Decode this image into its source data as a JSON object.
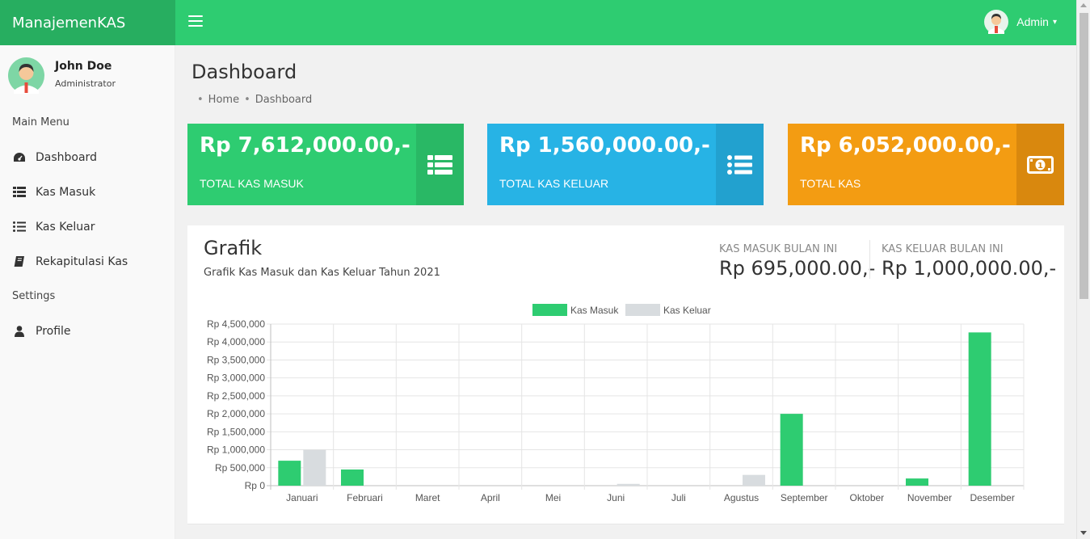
{
  "app": {
    "brand": "ManajemenKAS"
  },
  "topbar": {
    "user_label": "Admin"
  },
  "sidebar": {
    "user": {
      "name": "John Doe",
      "role": "Administrator"
    },
    "main_header": "Main Menu",
    "main_items": [
      {
        "label": "Dashboard",
        "icon": "dashboard-icon"
      },
      {
        "label": "Kas Masuk",
        "icon": "list-icon"
      },
      {
        "label": "Kas Keluar",
        "icon": "list-bullet-icon"
      },
      {
        "label": "Rekapitulasi Kas",
        "icon": "book-icon"
      }
    ],
    "settings_header": "Settings",
    "settings_items": [
      {
        "label": "Profile",
        "icon": "user-icon"
      }
    ]
  },
  "page": {
    "title": "Dashboard",
    "breadcrumb": [
      "Home",
      "Dashboard"
    ]
  },
  "boxes": [
    {
      "amount": "Rp 7,612,000.00,-",
      "label": "TOTAL KAS MASUK",
      "color": "#2ecc71",
      "icon": "table-list-icon"
    },
    {
      "amount": "Rp 1,560,000.00,-",
      "label": "TOTAL KAS KELUAR",
      "color": "#27b3e5",
      "icon": "list-bullet-icon"
    },
    {
      "amount": "Rp 6,052,000.00,-",
      "label": "TOTAL KAS",
      "color": "#f39c12",
      "icon": "money-icon"
    }
  ],
  "grafik": {
    "title": "Grafik",
    "subtitle": "Grafik Kas Masuk dan Kas Keluar Tahun 2021",
    "stats": [
      {
        "label": "KAS MASUK BULAN INI",
        "value": "Rp 695,000.00,-"
      },
      {
        "label": "KAS KELUAR BULAN INI",
        "value": "Rp 1,000,000.00,-"
      }
    ]
  },
  "chart_data": {
    "type": "bar",
    "categories": [
      "Januari",
      "Februari",
      "Maret",
      "April",
      "Mei",
      "Juni",
      "Juli",
      "Agustus",
      "September",
      "Oktober",
      "November",
      "Desember"
    ],
    "series": [
      {
        "name": "Kas Masuk",
        "color": "#2ecc71",
        "values": [
          695000,
          450000,
          0,
          0,
          0,
          0,
          0,
          0,
          2000000,
          0,
          200000,
          4267000
        ]
      },
      {
        "name": "Kas Keluar",
        "color": "#d8dcdf",
        "values": [
          1000000,
          0,
          0,
          0,
          0,
          50000,
          0,
          300000,
          0,
          0,
          0,
          0
        ]
      }
    ],
    "y_ticks": [
      "Rp 0",
      "Rp 500,000",
      "Rp 1,000,000",
      "Rp 1,500,000",
      "Rp 2,000,000",
      "Rp 2,500,000",
      "Rp 3,000,000",
      "Rp 3,500,000",
      "Rp 4,000,000",
      "Rp 4,500,000"
    ],
    "ylim": [
      0,
      4500000
    ],
    "legend": "top",
    "grid": true
  }
}
